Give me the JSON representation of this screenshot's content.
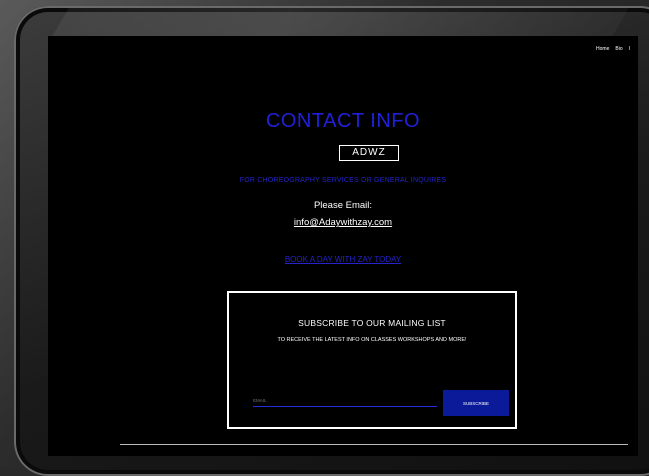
{
  "nav": {
    "home": "Home",
    "bio": "Bio",
    "more": "I"
  },
  "contact": {
    "title": "CONTACT INFO",
    "logo": "ADWZ",
    "subtitle": "FOR CHOREOGRAPHY SERVICES OR GENERAL INQUIRES",
    "please_email": "Please Email:",
    "email": "info@Adaywithzay.com",
    "book_link": "BOOK A DAY WITH ZAY TODAY"
  },
  "subscribe": {
    "title": "SUBSCRIBE TO OUR MAILING LIST",
    "text": "TO RECEIVE THE LATEST INFO ON CLASSES WORKSHOPS AND MORE!",
    "input_placeholder": "EMAIL",
    "button_label": "SUBSCRIBE"
  },
  "colors": {
    "accent": "#2424c8",
    "button": "#0a1a99",
    "background": "#000000"
  }
}
